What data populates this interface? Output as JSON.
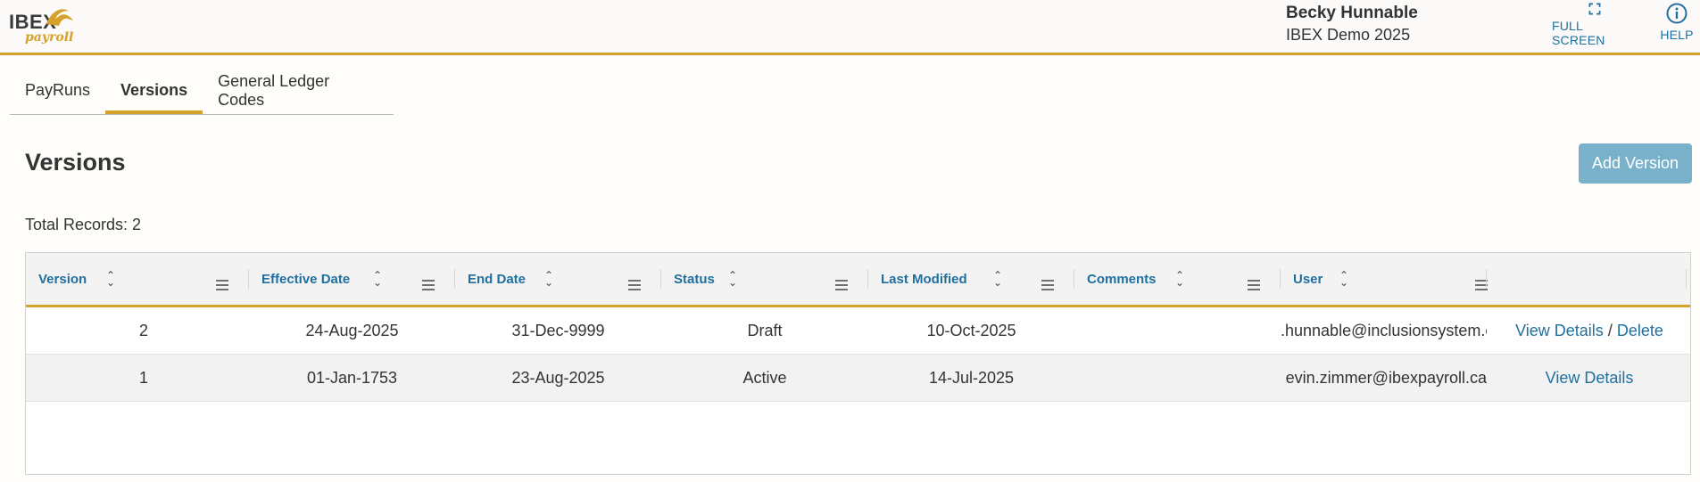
{
  "header": {
    "logo_text": "IBEX",
    "logo_subtext": "payroll",
    "user_name": "Becky Hunnable",
    "company": "IBEX Demo 2025",
    "fullscreen_label": "FULL SCREEN",
    "help_label": "HELP"
  },
  "tabs": [
    {
      "label": "PayRuns"
    },
    {
      "label": "Versions"
    },
    {
      "label": "General Ledger Codes"
    }
  ],
  "page": {
    "title": "Versions",
    "add_button": "Add Version",
    "total_records": "Total Records: 2"
  },
  "grid": {
    "columns": [
      "Version",
      "Effective Date",
      "End Date",
      "Status",
      "Last Modified",
      "Comments",
      "User"
    ],
    "rows": [
      {
        "version": "2",
        "effective": "24-Aug-2025",
        "end": "31-Dec-9999",
        "status": "Draft",
        "modified": "10-Oct-2025",
        "comments": "",
        "user": ".hunnable@inclusionsystem.c",
        "view": "View Details",
        "slash": "/",
        "delete": "Delete"
      },
      {
        "version": "1",
        "effective": "01-Jan-1753",
        "end": "23-Aug-2025",
        "status": "Active",
        "modified": "14-Jul-2025",
        "comments": "",
        "user": "evin.zimmer@ibexpayroll.ca",
        "view": "View Details"
      }
    ]
  },
  "colors": {
    "accent": "#d4a22a",
    "link": "#1f6f9f",
    "button": "#7ab1ca"
  }
}
